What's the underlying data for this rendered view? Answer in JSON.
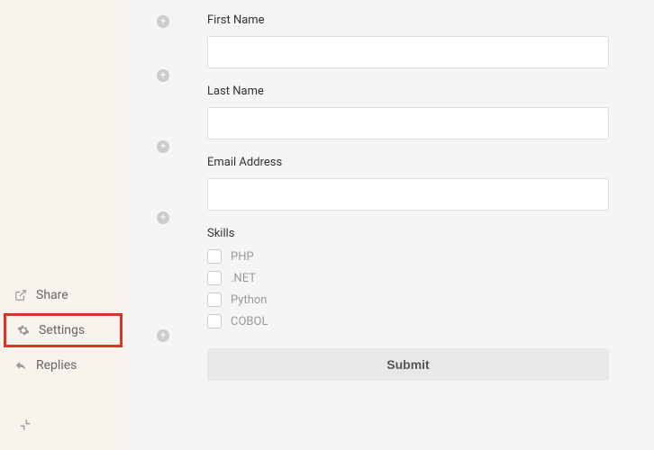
{
  "sidebar": {
    "items": [
      {
        "label": "Share",
        "icon": "external-link-icon"
      },
      {
        "label": "Settings",
        "icon": "gear-icon"
      },
      {
        "label": "Replies",
        "icon": "reply-icon"
      }
    ]
  },
  "form": {
    "fields": [
      {
        "label": "First Name",
        "type": "text",
        "value": ""
      },
      {
        "label": "Last Name",
        "type": "text",
        "value": ""
      },
      {
        "label": "Email Address",
        "type": "text",
        "value": ""
      },
      {
        "label": "Skills",
        "type": "checkbox",
        "options": [
          "PHP",
          ".NET",
          "Python",
          "COBOL"
        ]
      }
    ],
    "submit_label": "Submit"
  }
}
